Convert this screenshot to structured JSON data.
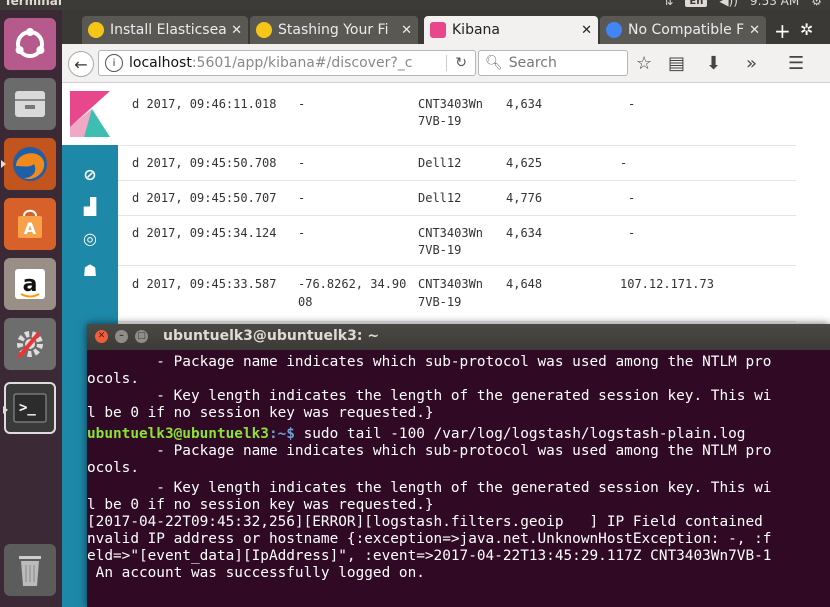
{
  "top_panel": {
    "title": "Terminal",
    "lang": "En",
    "time": "9:53 AM"
  },
  "browser": {
    "tabs": [
      {
        "label": "Install Elasticsea",
        "icon_color": "#f5c518"
      },
      {
        "label": "Stashing Your Fi",
        "icon_color": "#f5c518"
      },
      {
        "label": "Kibana",
        "icon_color": "#e8488b"
      },
      {
        "label": "No Compatible F",
        "icon_color": "#4285f4"
      }
    ],
    "new_tab": "+",
    "url_host": "localhost",
    "url_path": ":5601/app/kibana#/discover?_c",
    "search_placeholder": "Search"
  },
  "kibana": {
    "rows": [
      {
        "time": "d 2017, 09:46:11.018",
        "geo": "-",
        "geo2": "",
        "host": "CNT3403Wn",
        "host2": "7VB-19",
        "event": "4,634",
        "ip": "-"
      },
      {
        "time": "d 2017, 09:45:50.708",
        "geo": "-",
        "geo2": "",
        "host": "Dell12",
        "host2": "",
        "event": "4,625",
        "ip": "-"
      },
      {
        "time": "d 2017, 09:45:50.707",
        "geo": "-",
        "geo2": "",
        "host": "Dell12",
        "host2": "",
        "event": "4,776",
        "ip": "-"
      },
      {
        "time": "d 2017, 09:45:34.124",
        "geo": "-",
        "geo2": "",
        "host": "CNT3403Wn",
        "host2": "7VB-19",
        "event": "4,634",
        "ip": "-"
      },
      {
        "time": "d 2017, 09:45:33.587",
        "geo": "-76.8262, 34.90",
        "geo2": "08",
        "host": "CNT3403Wn",
        "host2": "7VB-19",
        "event": "4,648",
        "ip": "107.12.171.73"
      }
    ]
  },
  "terminal": {
    "title": "ubuntuelk3@ubuntuelk3: ~",
    "prompt_user": "ubuntuelk3@ubuntuelk3",
    "prompt_path": ":~$ ",
    "command": "sudo tail -100 /var/log/logstash/logstash-plain.log",
    "lines": [
      "        - Package name indicates which sub-protocol was used among the NTLM pro",
      "ocols.",
      "        - Key length indicates the length of the generated session key. This wi",
      "l be 0 if no session key was requested.}",
      "        - Package name indicates which sub-protocol was used among the NTLM pro",
      "ocols.",
      "        - Key length indicates the length of the generated session key. This wi",
      "l be 0 if no session key was requested.}",
      "[2017-04-22T09:45:32,256][ERROR][logstash.filters.geoip   ] IP Field contained",
      "nvalid IP address or hostname {:exception=>java.net.UnknownHostException: -, :f",
      "eld=>\"[event_data][IpAddress]\", :event=>2017-04-22T13:45:29.117Z CNT3403Wn7VB-1",
      " An account was successfully logged on."
    ]
  }
}
